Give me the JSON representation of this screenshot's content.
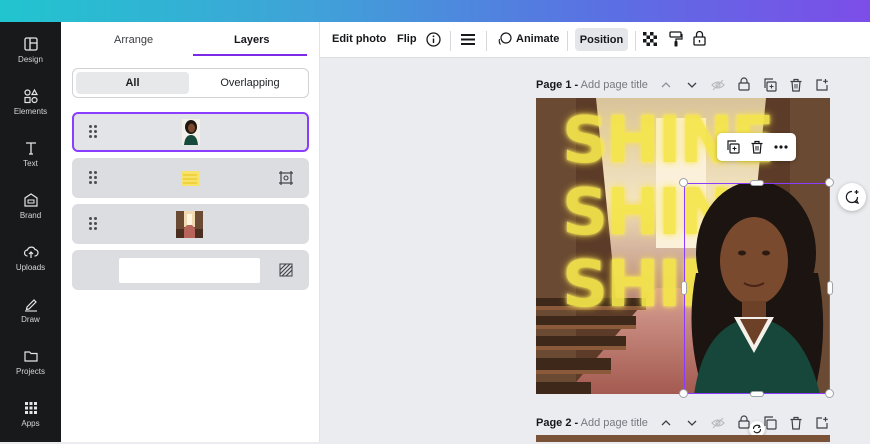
{
  "rail": {
    "items": [
      {
        "label": "Design",
        "icon": "layout-icon"
      },
      {
        "label": "Elements",
        "icon": "shapes-icon"
      },
      {
        "label": "Text",
        "icon": "text-icon"
      },
      {
        "label": "Brand",
        "icon": "brand-icon"
      },
      {
        "label": "Uploads",
        "icon": "cloud-upload-icon"
      },
      {
        "label": "Draw",
        "icon": "pen-icon"
      },
      {
        "label": "Projects",
        "icon": "folder-icon"
      },
      {
        "label": "Apps",
        "icon": "apps-grid-icon"
      }
    ]
  },
  "panel": {
    "tabs": [
      {
        "label": "Arrange"
      },
      {
        "label": "Layers",
        "active": true
      }
    ],
    "filter": {
      "all": "All",
      "overlapping": "Overlapping"
    },
    "layers": [
      {
        "kind": "photo",
        "thumb": "woman-portrait",
        "selected": true
      },
      {
        "kind": "text-shine",
        "thumb": "yellow-text",
        "action_icon": "frame-icon"
      },
      {
        "kind": "photo",
        "thumb": "church-interior"
      },
      {
        "kind": "background",
        "thumb": "white-background",
        "action_icon": "transparency-icon"
      }
    ]
  },
  "toolbar": {
    "edit_photo": "Edit photo",
    "flip": "Flip",
    "animate": "Animate",
    "position": "Position"
  },
  "pages": [
    {
      "label": "Page 1 -",
      "placeholder": "Add page title"
    },
    {
      "label": "Page 2 -",
      "placeholder": "Add page title"
    }
  ],
  "artwork": {
    "shine_text": [
      "SHINE",
      "SHINE",
      "SHINE"
    ],
    "accent": "#8b3dff",
    "shine_color": "#f5e64a"
  }
}
